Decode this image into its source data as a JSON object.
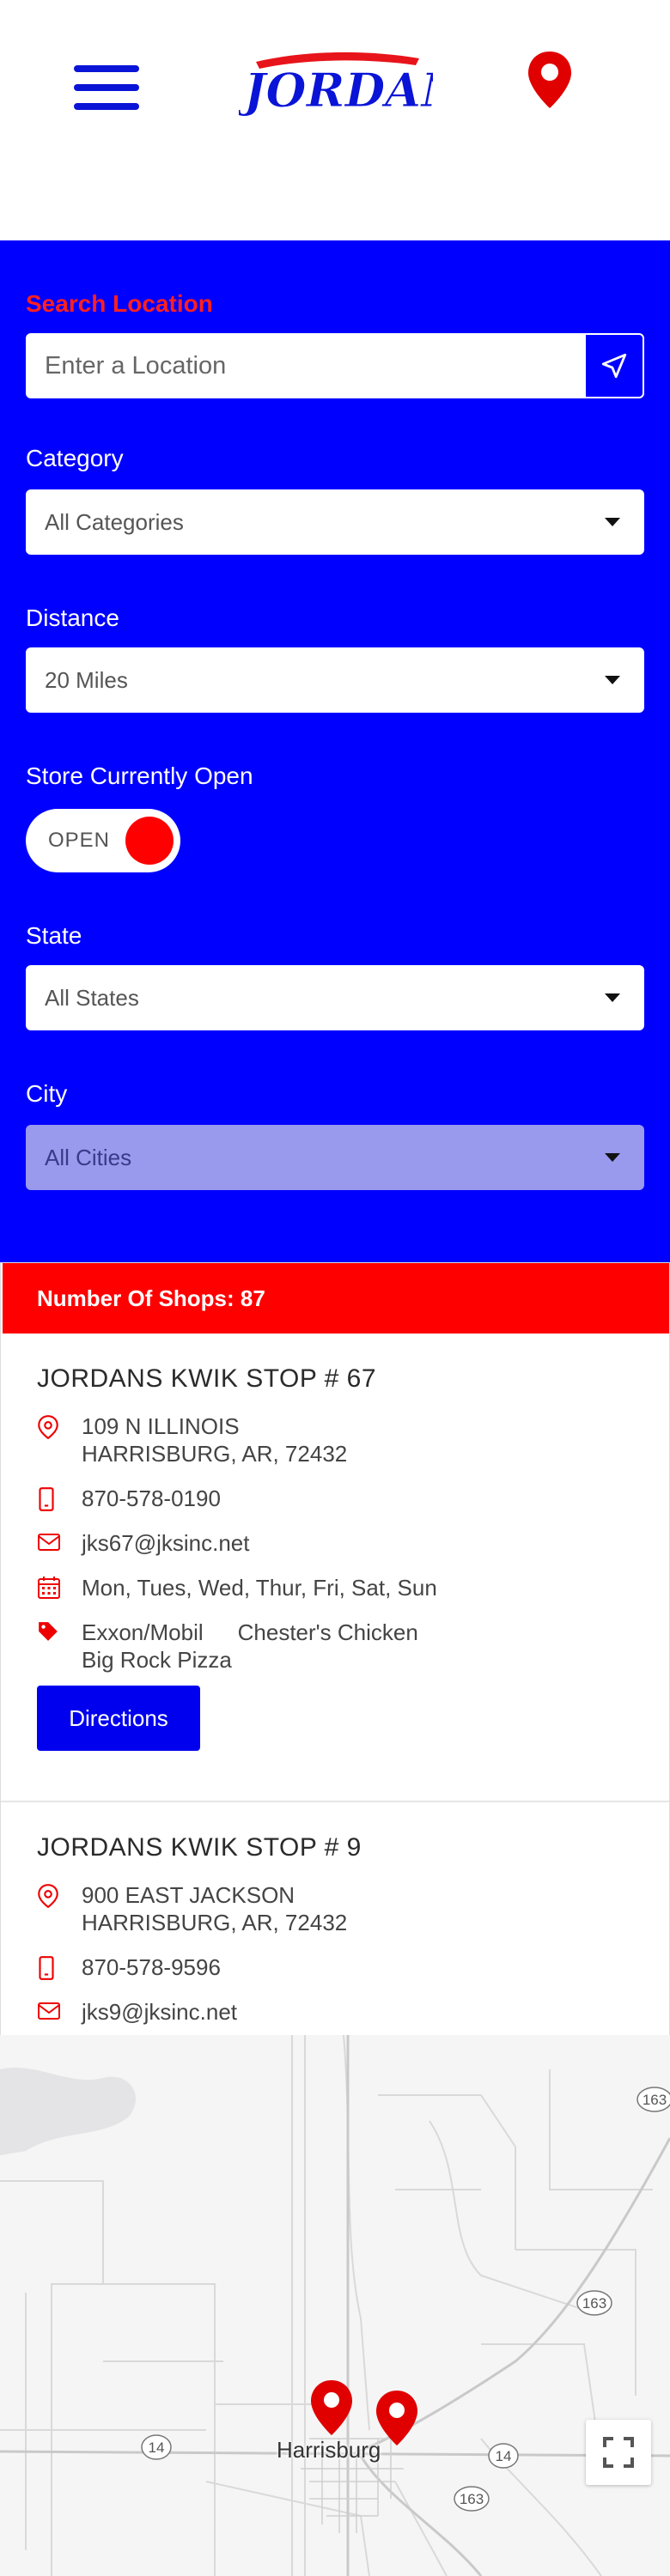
{
  "header": {
    "menu_icon": "hamburger-menu-icon",
    "logo_text": "JORDAN'S",
    "location_icon": "map-pin-icon",
    "brand_blue": "#0000ff",
    "brand_red": "#ff0000"
  },
  "filters": {
    "search_label": "Search Location",
    "search_placeholder": "Enter a Location",
    "category_label": "Category",
    "category_value": "All Categories",
    "distance_label": "Distance",
    "distance_value": "20 Miles",
    "open_label": "Store Currently Open",
    "open_toggle_text": "OPEN",
    "state_label": "State",
    "state_value": "All States",
    "city_label": "City",
    "city_value": "All Cities"
  },
  "results": {
    "count_text": "Number Of Shops: 87",
    "shops": [
      {
        "name": "JORDANS KWIK STOP # 67",
        "address_line1": "109 N ILLINOIS",
        "address_line2": "HARRISBURG, AR, 72432",
        "phone": "870-578-0190",
        "email": "jks67@jksinc.net",
        "days": "Mon, Tues, Wed, Thur, Fri, Sat, Sun",
        "tags": [
          "Exxon/Mobil",
          "Chester's Chicken",
          "Big Rock Pizza"
        ],
        "directions_label": "Directions"
      },
      {
        "name": "JORDANS KWIK STOP # 9",
        "address_line1": "900 EAST JACKSON",
        "address_line2": "HARRISBURG, AR, 72432",
        "phone": "870-578-9596",
        "email": "jks9@jksinc.net"
      }
    ]
  },
  "map": {
    "city_label": "Harrisburg",
    "route_labels": [
      "163",
      "163",
      "14",
      "14",
      "163"
    ],
    "fullscreen_icon": "fullscreen-icon"
  }
}
